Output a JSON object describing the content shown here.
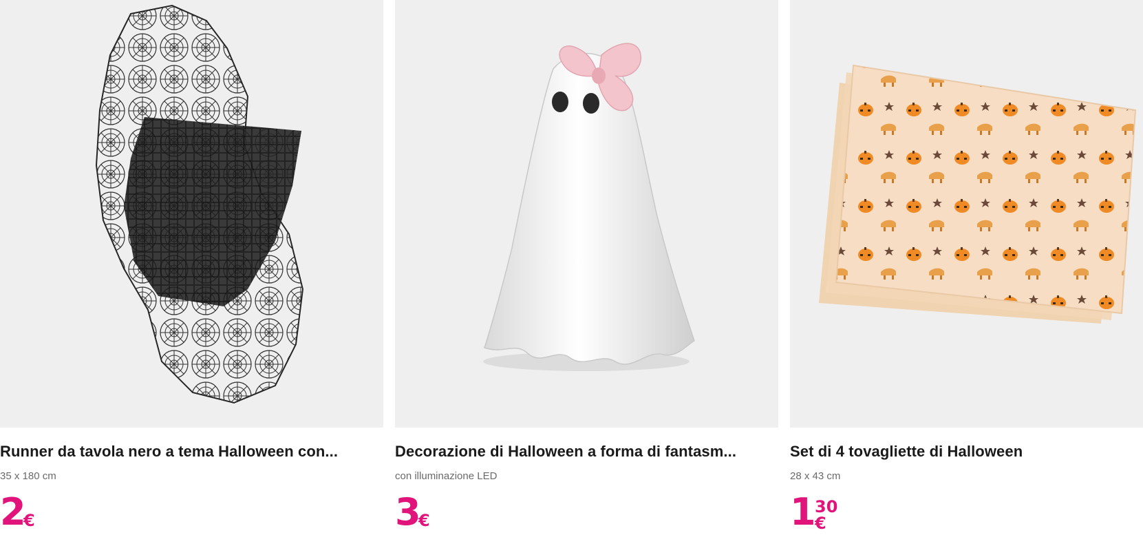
{
  "products": [
    {
      "title": "Runner da tavola nero a tema Halloween con...",
      "subtitle": "35 x 180 cm",
      "price_int": "2",
      "price_dec": "",
      "currency": "€",
      "image_icon": "spiderweb-table-runner-image"
    },
    {
      "title": "Decorazione di Halloween a forma di fantasm...",
      "subtitle": "con illuminazione LED",
      "price_int": "3",
      "price_dec": "",
      "currency": "€",
      "image_icon": "ghost-figurine-image"
    },
    {
      "title": "Set di 4 tovagliette di Halloween",
      "subtitle": "28 x 43 cm",
      "price_int": "1",
      "price_dec": "30",
      "currency": "€",
      "image_icon": "halloween-placemats-image"
    }
  ],
  "colors": {
    "price": "#e0147a",
    "image_bg": "#efefef",
    "title": "#1a1a1a",
    "subtitle": "#6a6a6a"
  }
}
